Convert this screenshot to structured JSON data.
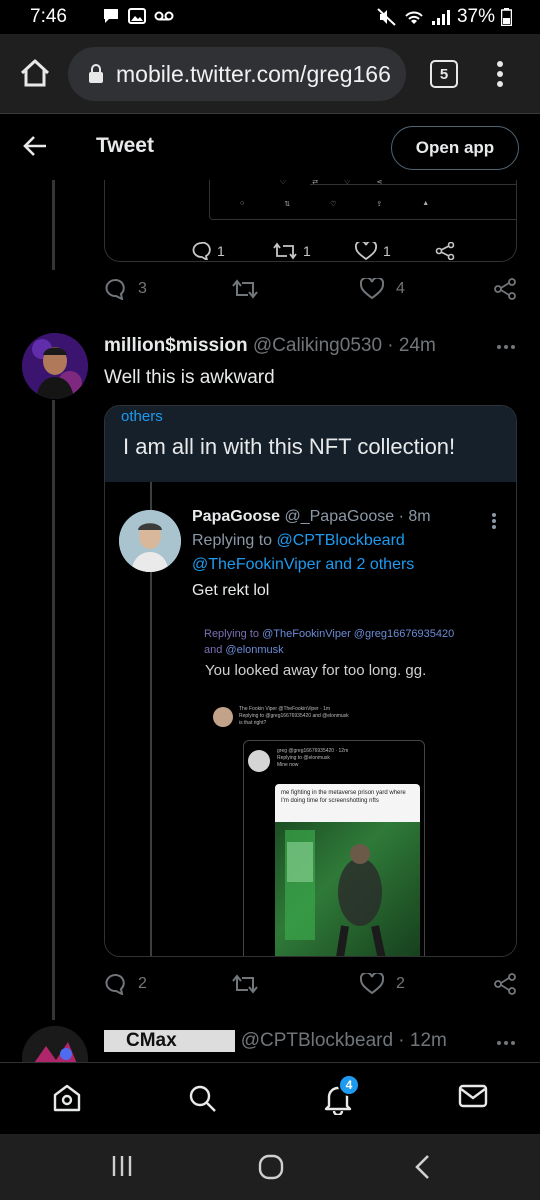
{
  "status_bar": {
    "time": "7:46",
    "battery": "37%"
  },
  "browser": {
    "url": "mobile.twitter.com/greg166",
    "tab_count": "5"
  },
  "header": {
    "title": "Tweet",
    "open_app_label": "Open app"
  },
  "top_quote": {
    "reply_count": "1",
    "retweet_count": "1",
    "like_count": "1"
  },
  "top_tweet_actions": {
    "reply_count": "3",
    "like_count": "4"
  },
  "tweet": {
    "name": "million$mission",
    "handle": "@Caliking0530 · 24m",
    "text": "Well this is awkward",
    "quote": {
      "context": "others",
      "text": "I am all in with this NFT collection!",
      "screenshot": {
        "author_name": "PapaGoose",
        "author_handle": "@_PapaGoose · 8m",
        "replying_prefix": "Replying to",
        "replying_user1": "@CPTBlockbeard",
        "replying_line2": "@TheFookinViper and 2 others",
        "text": "Get rekt lol",
        "nested_replying_prefix": "Replying to",
        "nested_replying_users": "@TheFookinViper @greg16676935420",
        "nested_replying_and": "and",
        "nested_replying_last": "@elonmusk",
        "nested_text": "You looked away for too long. gg.",
        "fv_name": "The Fookin Viper @TheFookinViper · 1m",
        "fv_reply": "Replying to @greg16676935420 and @elonmusk",
        "fv_text": "is that right?",
        "gr_name": "greg @greg16676935420 · 12m",
        "gr_reply": "Replying to @elonmusk",
        "gr_text": "Mine now",
        "meme_caption": "me fighting in the metaverse prison yard where I'm doing time for screenshotting nfts"
      }
    },
    "actions": {
      "reply_count": "2",
      "like_count": "2"
    }
  },
  "next_tweet": {
    "name_visible": "CMax",
    "handle": "@CPTBlockbeard · 12m"
  },
  "tabbar": {
    "notification_count": "4"
  }
}
